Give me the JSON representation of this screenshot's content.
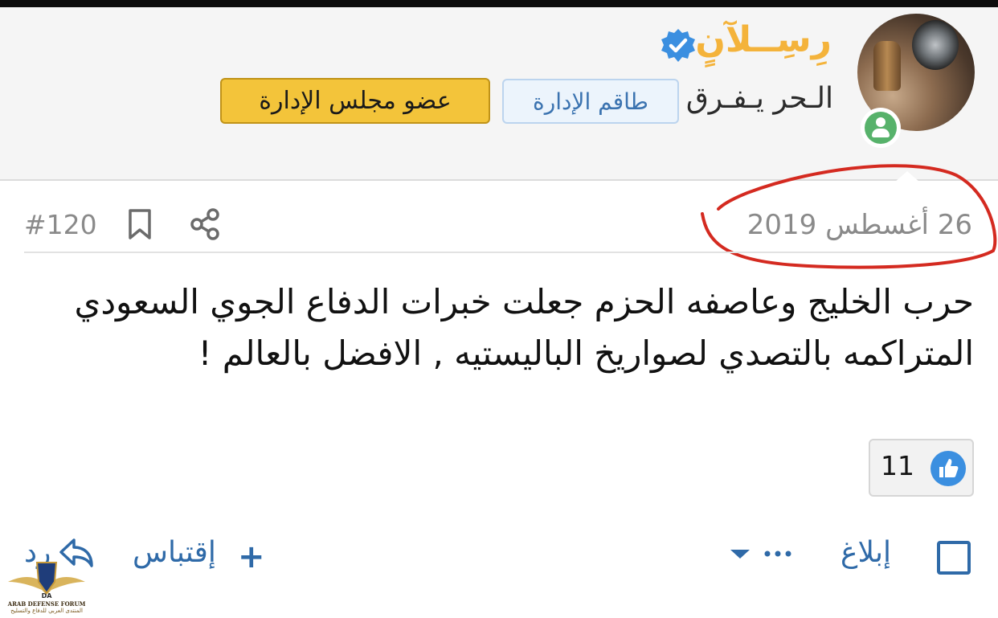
{
  "author": {
    "username": "رِسِــلآنٍ",
    "title": "الـحر يـفـرق",
    "badges": [
      "طاقم الإدارة",
      "عضو مجلس الإدارة"
    ],
    "status": "online",
    "verified": true
  },
  "post": {
    "date": "26 أغسطس 2019",
    "number": "#120",
    "body": "حرب الخليج وعاصفه الحزم جعلت خبرات الدفاع الجوي السعودي المتراكمه بالتصدي لصواريخ الباليستيه , الافضل بالعالم !",
    "reactions": {
      "type": "like",
      "count": "11"
    }
  },
  "actions": {
    "report": "إبلاغ",
    "more": "...",
    "quote": "إقتباس",
    "quote_prefix": "+",
    "reply": "رد"
  },
  "watermark": {
    "line1": "ARAB DEFENSE FORUM",
    "line2": "المنتدى العربي للدفاع والتسليح"
  },
  "colors": {
    "username": "#f4b33b",
    "link": "#2f6aa8",
    "online": "#57b26b",
    "verified": "#3b8fe0",
    "annotation": "#d42a20",
    "board_badge": "#f3c43a"
  }
}
